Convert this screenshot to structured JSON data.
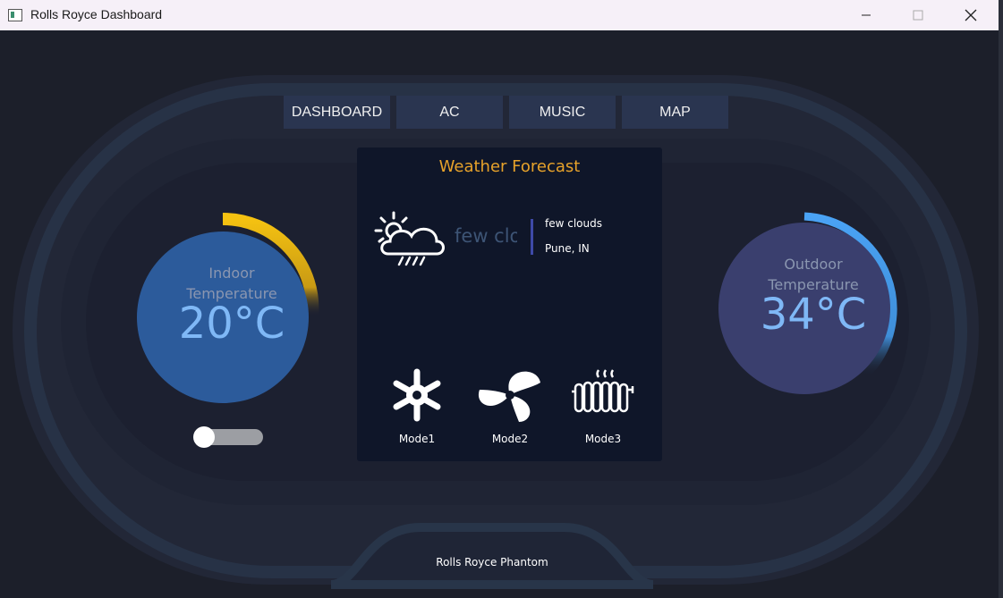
{
  "window": {
    "title": "Rolls Royce Dashboard"
  },
  "nav": {
    "items": [
      {
        "label": "DASHBOARD"
      },
      {
        "label": "AC"
      },
      {
        "label": "MUSIC"
      },
      {
        "label": "MAP"
      }
    ]
  },
  "weather": {
    "title": "Weather Forecast",
    "ticker_text": "few clouds",
    "description": "few clouds",
    "location": "Pune, IN",
    "icon": "cloud-rain-sun-icon"
  },
  "indoor": {
    "label_line1": "Indoor",
    "label_line2": "Temperature",
    "value": "20°C",
    "arc_color": "#f5c211",
    "fill_color": "#2c5b9b",
    "arc_fraction": 0.3
  },
  "outdoor": {
    "label_line1": "Outdoor",
    "label_line2": "Temperature",
    "value": "34°C",
    "arc_color": "#4aa3f5",
    "fill_color": "#3a3f6e",
    "arc_fraction": 0.36
  },
  "toggle": {
    "on": false
  },
  "modes": [
    {
      "label": "Mode1",
      "icon": "snowflake-icon"
    },
    {
      "label": "Mode2",
      "icon": "fan-icon"
    },
    {
      "label": "Mode3",
      "icon": "heater-icon"
    }
  ],
  "footer": {
    "label": "Rolls Royce Phantom"
  },
  "colors": {
    "accent": "#e7a22a",
    "background": "#1c1f2a",
    "nav_bg": "#2a3550",
    "panel_bg": "#0f1629"
  }
}
